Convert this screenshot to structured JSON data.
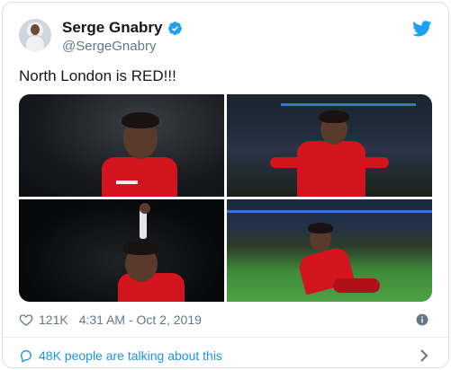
{
  "author": {
    "name": "Serge Gnabry",
    "handle": "@SergeGnabry",
    "verified": true
  },
  "tweet": {
    "text": "North London is RED!!!"
  },
  "media": {
    "photos": [
      {
        "alt": "player-celebrating-shouting"
      },
      {
        "alt": "player-celebrating-arms-out"
      },
      {
        "alt": "player-pointing-up"
      },
      {
        "alt": "player-knee-slide"
      }
    ]
  },
  "stats": {
    "likes": "121K",
    "timestamp": "4:31 AM - Oct 2, 2019"
  },
  "conversation": {
    "label": "48K people are talking about this"
  },
  "colors": {
    "twitter_blue": "#1da1f2",
    "link_blue": "#1b95e0",
    "muted": "#657786",
    "bayern_red": "#d3141f"
  }
}
